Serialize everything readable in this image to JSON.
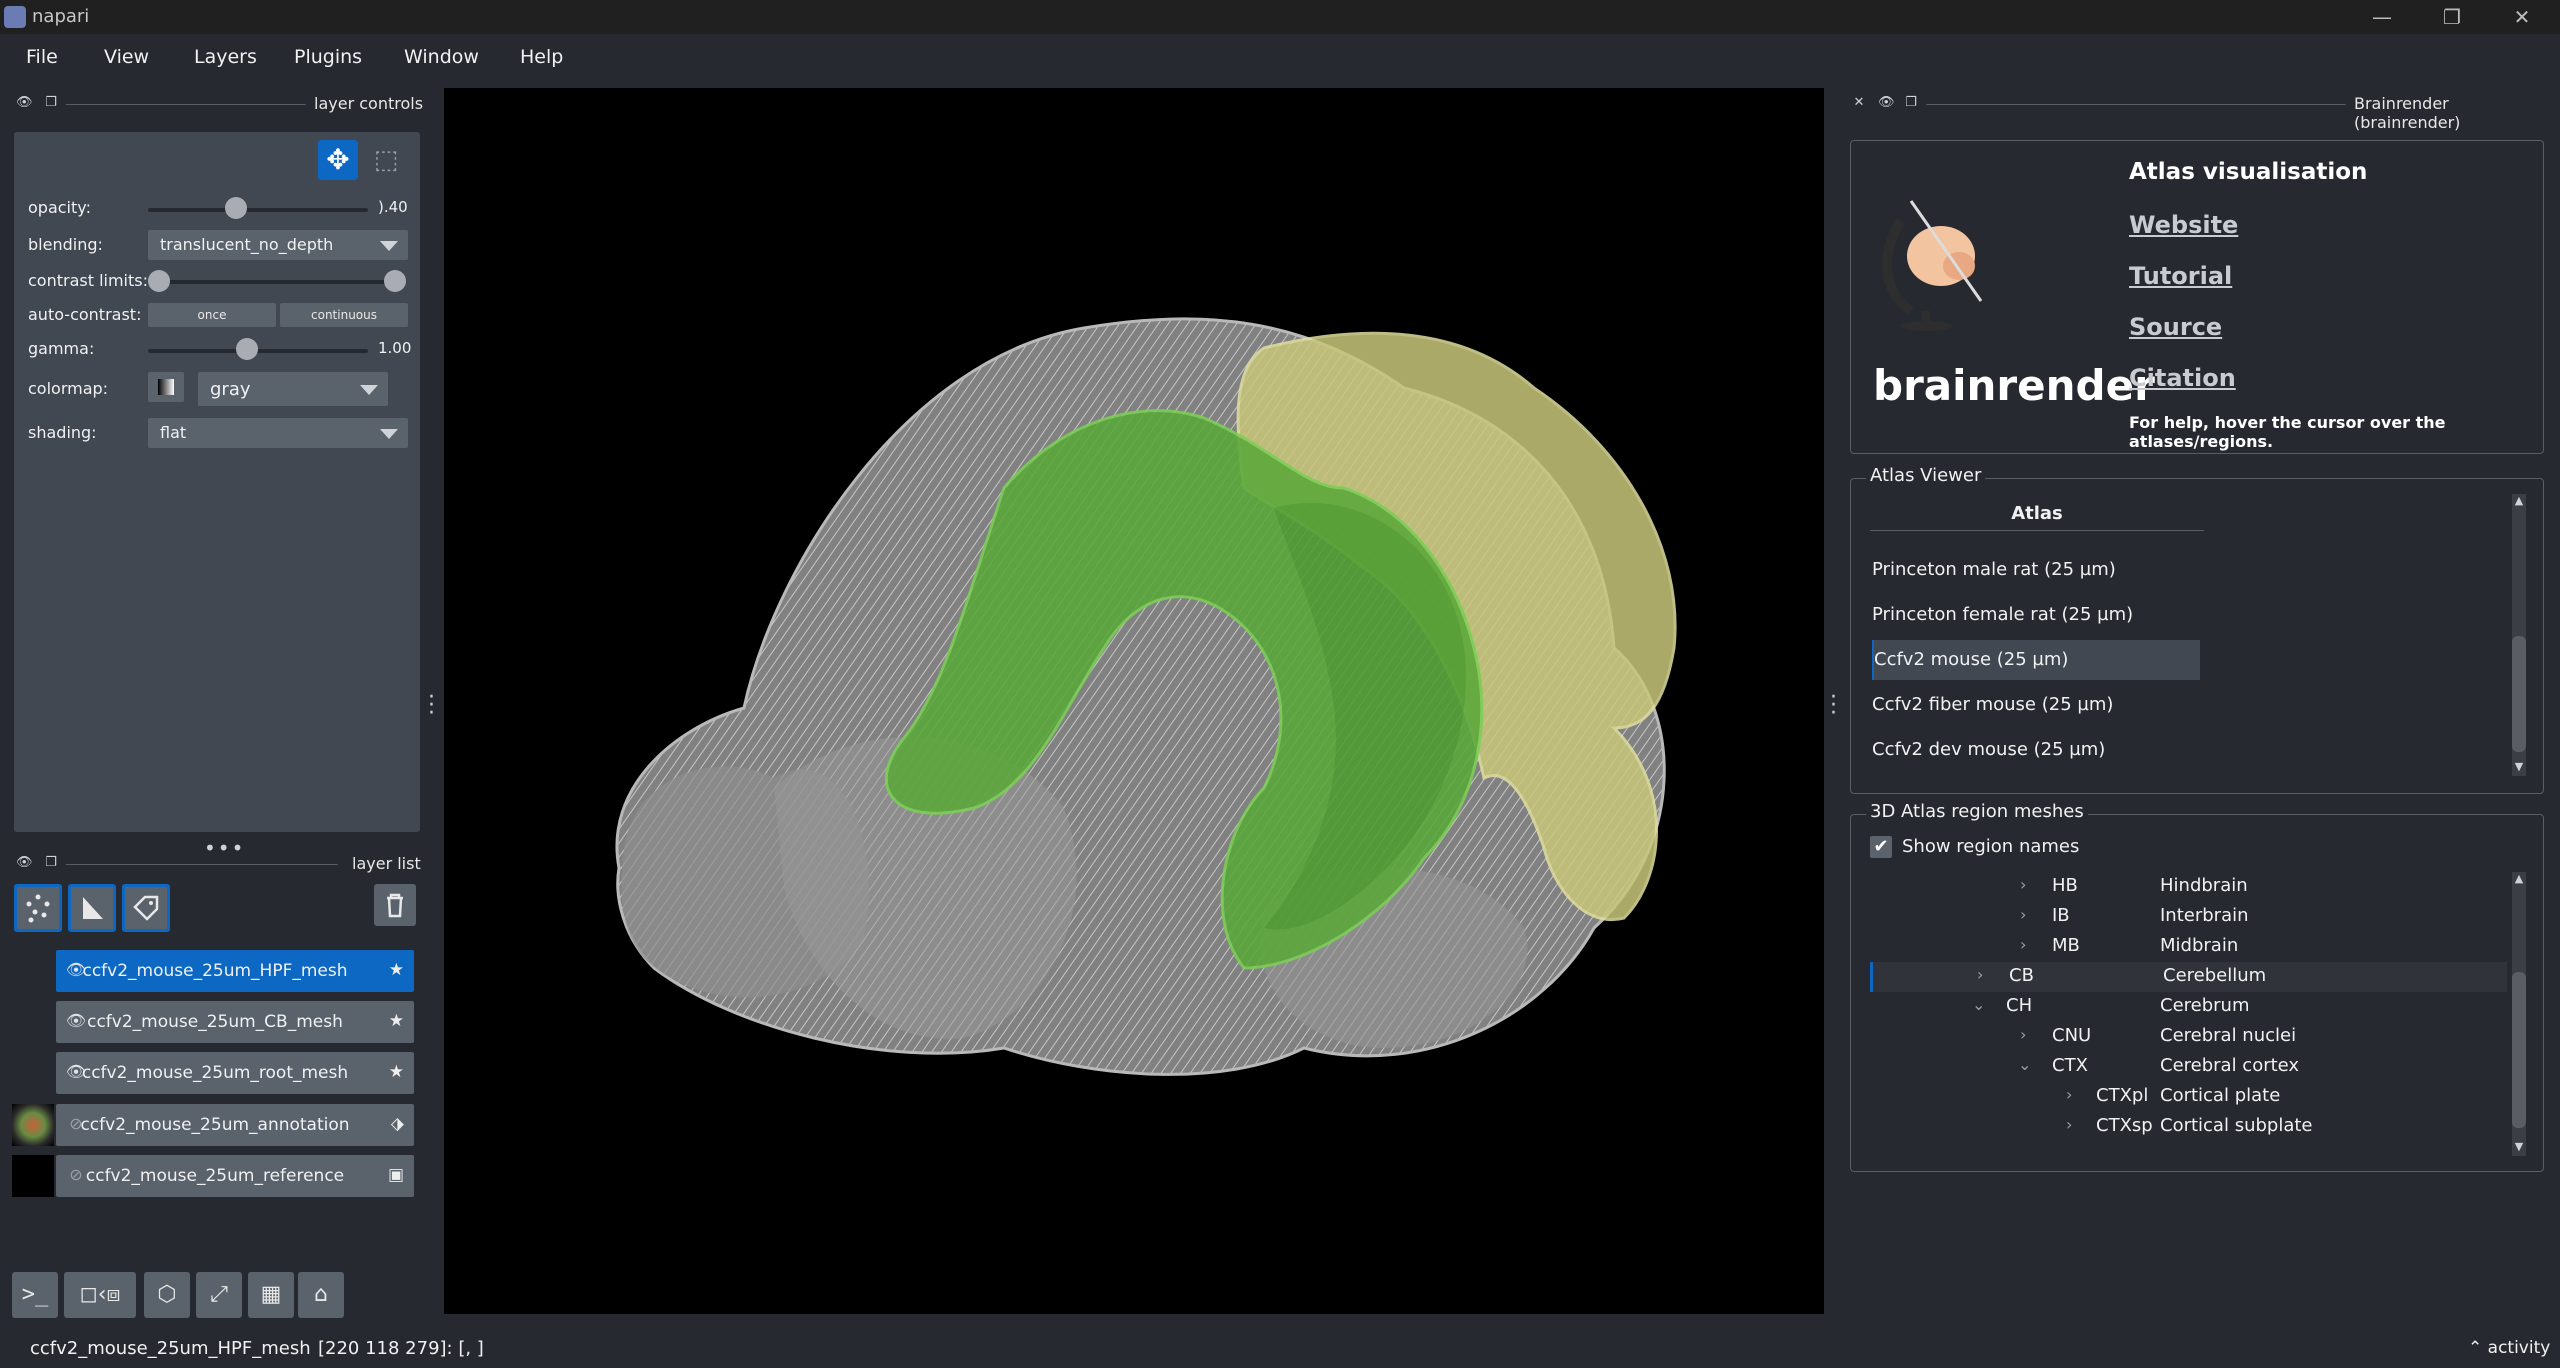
{
  "window": {
    "title": "napari"
  },
  "menu": [
    "File",
    "View",
    "Layers",
    "Plugins",
    "Window",
    "Help"
  ],
  "layer_controls": {
    "header": "layer controls",
    "opacity_label": "opacity:",
    "opacity_value": ").40",
    "opacity_level": 0.4,
    "blending_label": "blending:",
    "blending_value": "translucent_no_depth",
    "contrast_label": "contrast limits:",
    "contrast_range": [
      0.0,
      1.0
    ],
    "autocontrast_label": "auto-contrast:",
    "once_label": "once",
    "continuous_label": "continuous",
    "gamma_label": "gamma:",
    "gamma_value": "1.00",
    "gamma_level": 0.45,
    "colormap_label": "colormap:",
    "colormap_value": "gray",
    "shading_label": "shading:",
    "shading_value": "flat"
  },
  "layer_list": {
    "header": "layer list",
    "layers": [
      {
        "name": "ccfv2_mouse_25um_HPF_mesh",
        "visible": true,
        "selected": true,
        "type_icon": "star-icon"
      },
      {
        "name": "ccfv2_mouse_25um_CB_mesh",
        "visible": true,
        "selected": false,
        "type_icon": "star-icon"
      },
      {
        "name": "ccfv2_mouse_25um_root_mesh",
        "visible": true,
        "selected": false,
        "type_icon": "star-icon"
      },
      {
        "name": "ccfv2_mouse_25um_annotation",
        "visible": false,
        "selected": false,
        "type_icon": "label-tag-icon"
      },
      {
        "name": "ccfv2_mouse_25um_reference",
        "visible": false,
        "selected": false,
        "type_icon": "image-icon"
      }
    ]
  },
  "dock": {
    "title": "Brainrender (brainrender)",
    "header_title": "Atlas visualisation",
    "brand": "brainrender",
    "links": [
      "Website",
      "Tutorial",
      "Source",
      "Citation"
    ],
    "help_text": "For help, hover the cursor over the atlases/regions.",
    "atlas_viewer": {
      "title": "Atlas Viewer",
      "column": "Atlas",
      "rows": [
        "Princeton male rat (25 µm)",
        "Princeton female rat (25 µm)",
        "Ccfv2 mouse (25 µm)",
        "Ccfv2 fiber mouse (25 µm)",
        "Ccfv2 dev mouse (25 µm)"
      ],
      "selected_index": 2
    },
    "region_meshes": {
      "title": "3D Atlas region meshes",
      "show_names_label": "Show region names",
      "show_names_checked": true,
      "tree": [
        {
          "acr": "HB",
          "name": "Hindbrain",
          "depth": 2,
          "expanded": false
        },
        {
          "acr": "IB",
          "name": "Interbrain",
          "depth": 2,
          "expanded": false
        },
        {
          "acr": "MB",
          "name": "Midbrain",
          "depth": 2,
          "expanded": false
        },
        {
          "acr": "CB",
          "name": "Cerebellum",
          "depth": 1,
          "expanded": false
        },
        {
          "acr": "CH",
          "name": "Cerebrum",
          "depth": 1,
          "expanded": true
        },
        {
          "acr": "CNU",
          "name": "Cerebral nuclei",
          "depth": 2,
          "expanded": false
        },
        {
          "acr": "CTX",
          "name": "Cerebral cortex",
          "depth": 2,
          "expanded": true
        },
        {
          "acr": "CTXpl",
          "name": "Cortical plate",
          "depth": 3,
          "expanded": false
        },
        {
          "acr": "CTXsp",
          "name": "Cortical subplate",
          "depth": 3,
          "expanded": false
        }
      ]
    }
  },
  "status": {
    "layer": "ccfv2_mouse_25um_HPF_mesh",
    "coords": "[220 118 279]: [, ]",
    "activity": "activity"
  },
  "colors": {
    "accent": "#0d68c4",
    "bg": "#262930",
    "panel": "#414851",
    "widget": "#5a626c",
    "mesh_root": "#bdbdbd",
    "mesh_hpf": "#5aa83a",
    "mesh_cb": "#c9c77a"
  }
}
